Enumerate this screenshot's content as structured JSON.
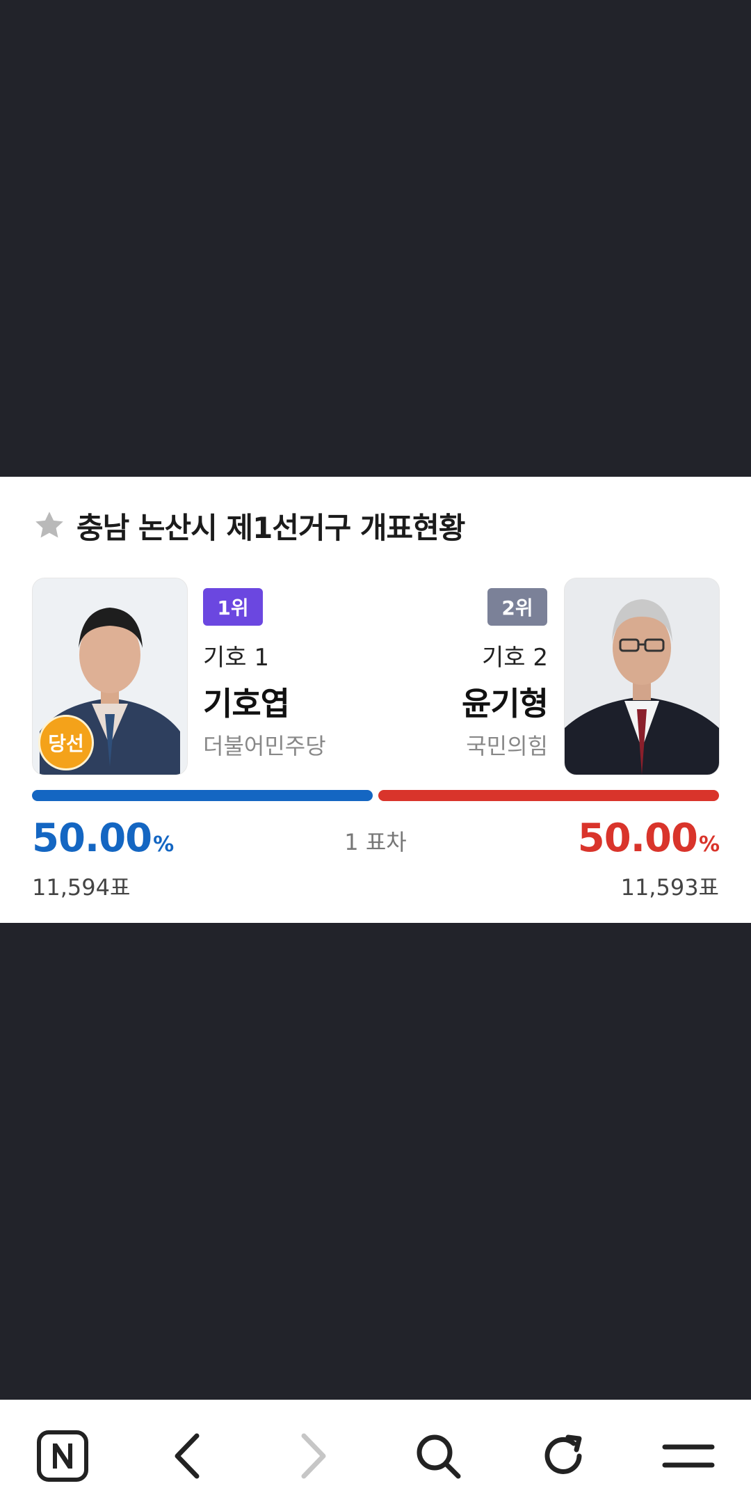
{
  "card": {
    "title": "충남 논산시 제1선거구 개표현황",
    "difference": "1 표차",
    "colors": {
      "left": "#1466c2",
      "right": "#d9342b"
    }
  },
  "candidates": [
    {
      "rank": "1위",
      "symbol": "기호 1",
      "name": "기호엽",
      "party": "더불어민주당",
      "percent": "50.00",
      "percent_unit": "%",
      "votes": "11,594표",
      "winner_badge": "당선",
      "bar_share": 0.5
    },
    {
      "rank": "2위",
      "symbol": "기호 2",
      "name": "윤기형",
      "party": "국민의힘",
      "percent": "50.00",
      "percent_unit": "%",
      "votes": "11,593표",
      "bar_share": 0.5
    }
  ],
  "navbar": {
    "icons": [
      "naver-home-icon",
      "back-icon",
      "forward-icon",
      "search-icon",
      "refresh-icon",
      "menu-icon"
    ]
  }
}
